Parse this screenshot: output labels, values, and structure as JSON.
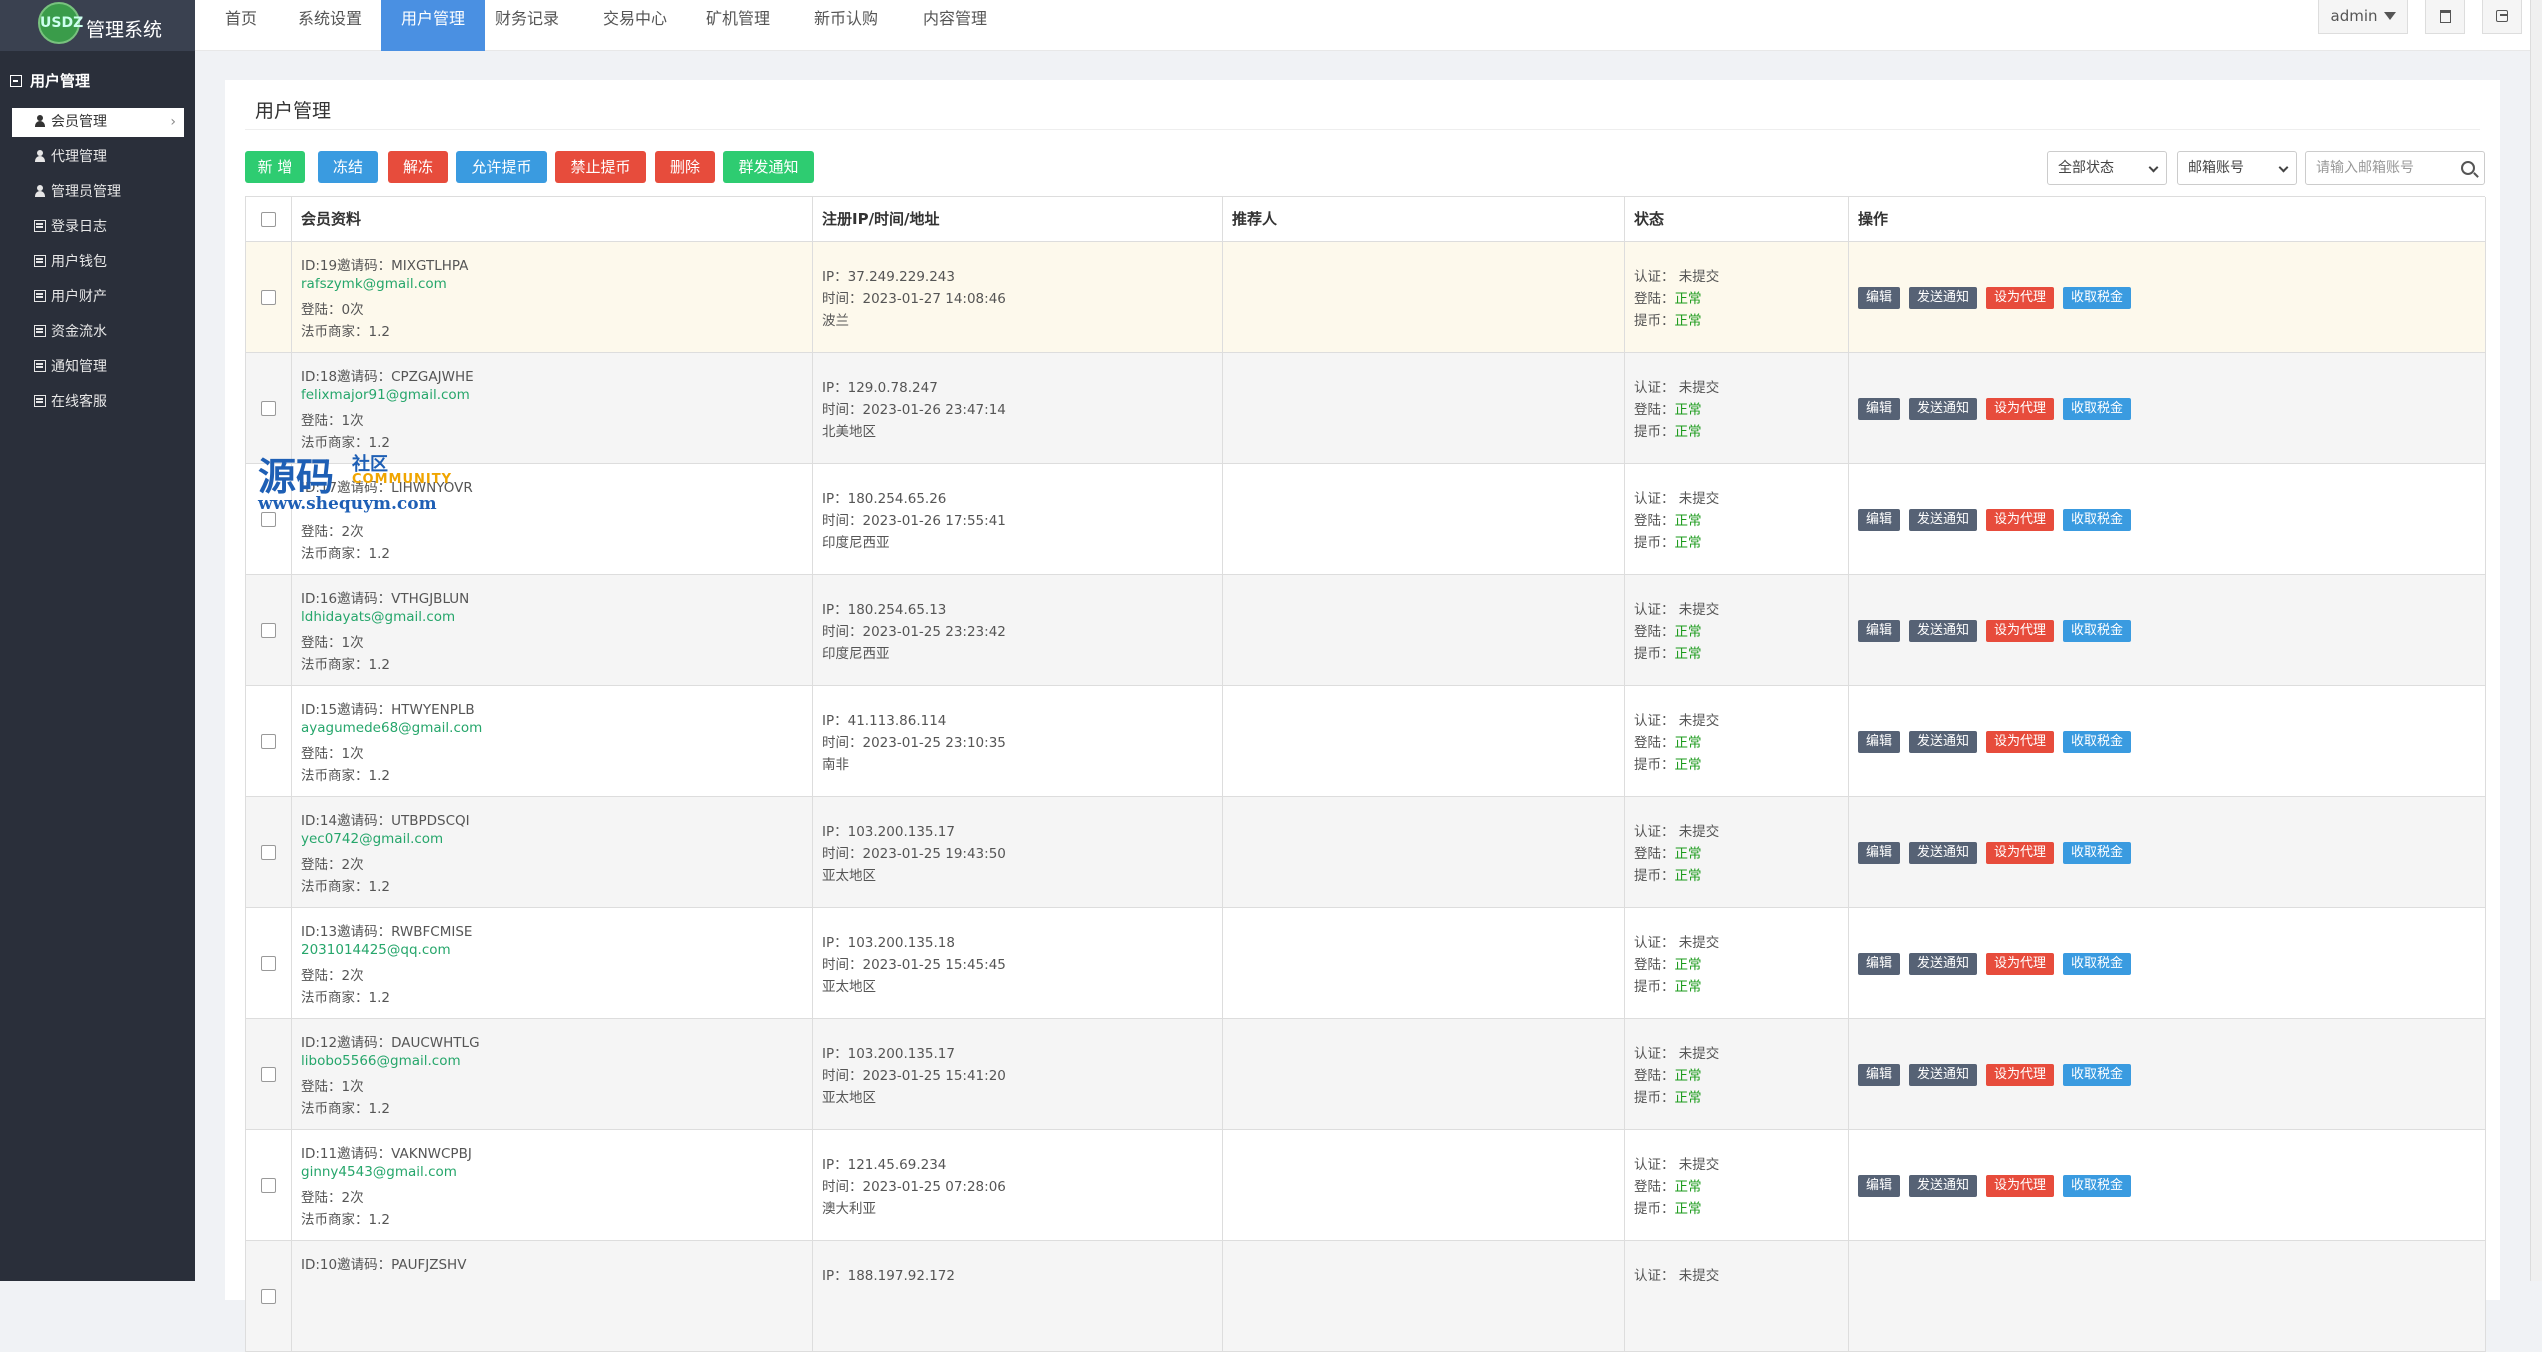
{
  "brand": {
    "logo_text": "USDZ",
    "title": "管理系统"
  },
  "sidebar": {
    "section": "用户管理",
    "items": [
      {
        "label": "会员管理",
        "icon": "user-icon",
        "active": true
      },
      {
        "label": "代理管理",
        "icon": "user-icon"
      },
      {
        "label": "管理员管理",
        "icon": "user-icon"
      },
      {
        "label": "登录日志",
        "icon": "list-icon"
      },
      {
        "label": "用户钱包",
        "icon": "list-icon"
      },
      {
        "label": "用户财产",
        "icon": "list-icon"
      },
      {
        "label": "资金流水",
        "icon": "list-icon"
      },
      {
        "label": "通知管理",
        "icon": "list-icon"
      },
      {
        "label": "在线客服",
        "icon": "list-icon"
      }
    ],
    "arrow": "›"
  },
  "topnav": {
    "items": [
      "首页",
      "系统设置",
      "用户管理",
      "财务记录",
      "交易中心",
      "矿机管理",
      "新币认购",
      "内容管理"
    ],
    "active_index": 2,
    "user": "admin"
  },
  "panel": {
    "title": "用户管理",
    "actions": [
      "新 增",
      "冻结",
      "解冻",
      "允许提币",
      "禁止提币",
      "删除",
      "群发通知"
    ],
    "status_filter": "全部状态",
    "account_filter": "邮箱账号",
    "search_placeholder": "请输入邮箱账号"
  },
  "table": {
    "headers": [
      "会员资料",
      "注册IP/时间/地址",
      "推荐人",
      "状态",
      "操作"
    ],
    "op_labels": [
      "编辑",
      "发送通知",
      "设为代理",
      "收取税金"
    ],
    "rows": [
      {
        "id_line": "ID:19邀请码：MIXGTLHPA",
        "email": "rafszymk@gmail.com",
        "login": "登陆：0次",
        "merchant": "法币商家：1.2",
        "ip": "IP：37.249.229.243",
        "time": "时间：2023-01-27 14:08:46",
        "region": "波兰",
        "ref": "",
        "auth": "认证：  未提交",
        "login_state_label": "登陆：",
        "login_state": "正常",
        "withdraw_label": "提币：",
        "withdraw_state": "正常"
      },
      {
        "id_line": "ID:18邀请码：CPZGAJWHE",
        "email": "felixmajor91@gmail.com",
        "login": "登陆：1次",
        "merchant": "法币商家：1.2",
        "ip": "IP：129.0.78.247",
        "time": "时间：2023-01-26 23:47:14",
        "region": "北美地区",
        "ref": "",
        "auth": "认证：  未提交",
        "login_state_label": "登陆：",
        "login_state": "正常",
        "withdraw_label": "提币：",
        "withdraw_state": "正常"
      },
      {
        "id_line": "ID:17邀请码：LIHWNYOVR",
        "email": "",
        "login": "登陆：2次",
        "merchant": "法币商家：1.2",
        "ip": "IP：180.254.65.26",
        "time": "时间：2023-01-26 17:55:41",
        "region": "印度尼西亚",
        "ref": "",
        "auth": "认证：  未提交",
        "login_state_label": "登陆：",
        "login_state": "正常",
        "withdraw_label": "提币：",
        "withdraw_state": "正常"
      },
      {
        "id_line": "ID:16邀请码：VTHGJBLUN",
        "email": "ldhidayats@gmail.com",
        "login": "登陆：1次",
        "merchant": "法币商家：1.2",
        "ip": "IP：180.254.65.13",
        "time": "时间：2023-01-25 23:23:42",
        "region": "印度尼西亚",
        "ref": "",
        "auth": "认证：  未提交",
        "login_state_label": "登陆：",
        "login_state": "正常",
        "withdraw_label": "提币：",
        "withdraw_state": "正常"
      },
      {
        "id_line": "ID:15邀请码：HTWYENPLB",
        "email": "ayagumede68@gmail.com",
        "login": "登陆：1次",
        "merchant": "法币商家：1.2",
        "ip": "IP：41.113.86.114",
        "time": "时间：2023-01-25 23:10:35",
        "region": "南非",
        "ref": "",
        "auth": "认证：  未提交",
        "login_state_label": "登陆：",
        "login_state": "正常",
        "withdraw_label": "提币：",
        "withdraw_state": "正常"
      },
      {
        "id_line": "ID:14邀请码：UTBPDSCQI",
        "email": "yec0742@gmail.com",
        "login": "登陆：2次",
        "merchant": "法币商家：1.2",
        "ip": "IP：103.200.135.17",
        "time": "时间：2023-01-25 19:43:50",
        "region": "亚太地区",
        "ref": "",
        "auth": "认证：  未提交",
        "login_state_label": "登陆：",
        "login_state": "正常",
        "withdraw_label": "提币：",
        "withdraw_state": "正常"
      },
      {
        "id_line": "ID:13邀请码：RWBFCMISE",
        "email": "2031014425@qq.com",
        "login": "登陆：2次",
        "merchant": "法币商家：1.2",
        "ip": "IP：103.200.135.18",
        "time": "时间：2023-01-25 15:45:45",
        "region": "亚太地区",
        "ref": "",
        "auth": "认证：  未提交",
        "login_state_label": "登陆：",
        "login_state": "正常",
        "withdraw_label": "提币：",
        "withdraw_state": "正常"
      },
      {
        "id_line": "ID:12邀请码：DAUCWHTLG",
        "email": "libobo5566@gmail.com",
        "login": "登陆：1次",
        "merchant": "法币商家：1.2",
        "ip": "IP：103.200.135.17",
        "time": "时间：2023-01-25 15:41:20",
        "region": "亚太地区",
        "ref": "",
        "auth": "认证：  未提交",
        "login_state_label": "登陆：",
        "login_state": "正常",
        "withdraw_label": "提币：",
        "withdraw_state": "正常"
      },
      {
        "id_line": "ID:11邀请码：VAKNWCPBJ",
        "email": "ginny4543@gmail.com",
        "login": "登陆：2次",
        "merchant": "法币商家：1.2",
        "ip": "IP：121.45.69.234",
        "time": "时间：2023-01-25 07:28:06",
        "region": "澳大利亚",
        "ref": "",
        "auth": "认证：  未提交",
        "login_state_label": "登陆：",
        "login_state": "正常",
        "withdraw_label": "提币：",
        "withdraw_state": "正常"
      },
      {
        "id_line": "ID:10邀请码：PAUFJZSHV",
        "email": "",
        "login": "",
        "merchant": "",
        "ip": "IP：188.197.92.172",
        "time": "",
        "region": "",
        "ref": "",
        "auth": "认证：  未提交",
        "login_state_label": "",
        "login_state": "",
        "withdraw_label": "",
        "withdraw_state": ""
      }
    ]
  },
  "watermark": {
    "big": "源码",
    "small": "社区",
    "community": "COMMUNITY",
    "url": "www.shequym.com"
  },
  "colors": {
    "sidebar_bg": "#2a2f3a",
    "accent": "#4a90e2",
    "green": "#2ecc71",
    "blue": "#3a9be0",
    "red": "#e74c3c",
    "email": "#26a66b",
    "ok": "#1a9a1a"
  }
}
